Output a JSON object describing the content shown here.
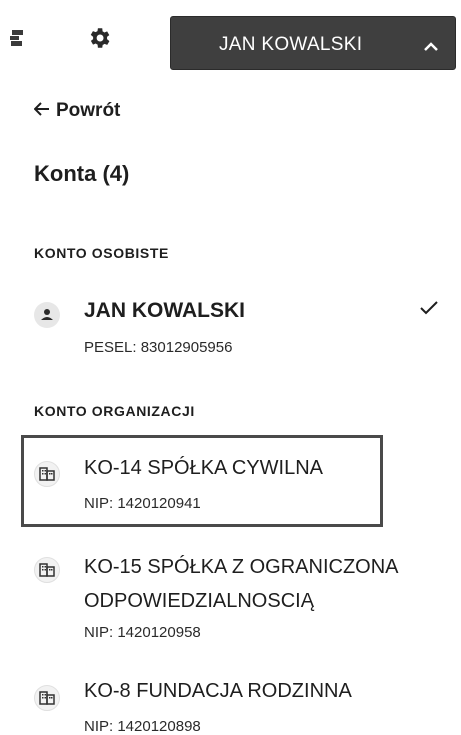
{
  "header": {
    "user_name": "JAN KOWALSKI"
  },
  "back_label": "Powrót",
  "title": "Konta (4)",
  "sections": {
    "personal": "KONTO OSOBISTE",
    "organization": "KONTO ORGANIZACJI"
  },
  "personal_account": {
    "name": "JAN KOWALSKI",
    "id": "PESEL: 83012905956"
  },
  "org_accounts": [
    {
      "name": "KO-14 SPÓŁKA CYWILNA",
      "id": "NIP: 1420120941"
    },
    {
      "name": "KO-15 SPÓŁKA Z OGRANICZONA ODPOWIEDZIALNOSCIĄ",
      "id": "NIP: 1420120958"
    },
    {
      "name": "KO-8 FUNDACJA RODZINNA",
      "id": "NIP: 1420120898"
    }
  ],
  "icons": {
    "menu": "menu-icon",
    "settings": "gear-icon",
    "expand": "chevron-up-icon",
    "back": "arrow-left-icon",
    "person": "person-icon",
    "building": "building-icon",
    "selected": "check-icon"
  },
  "colors": {
    "user_menu_bg": "#3f3f3f",
    "text": "#1e1e1e"
  }
}
